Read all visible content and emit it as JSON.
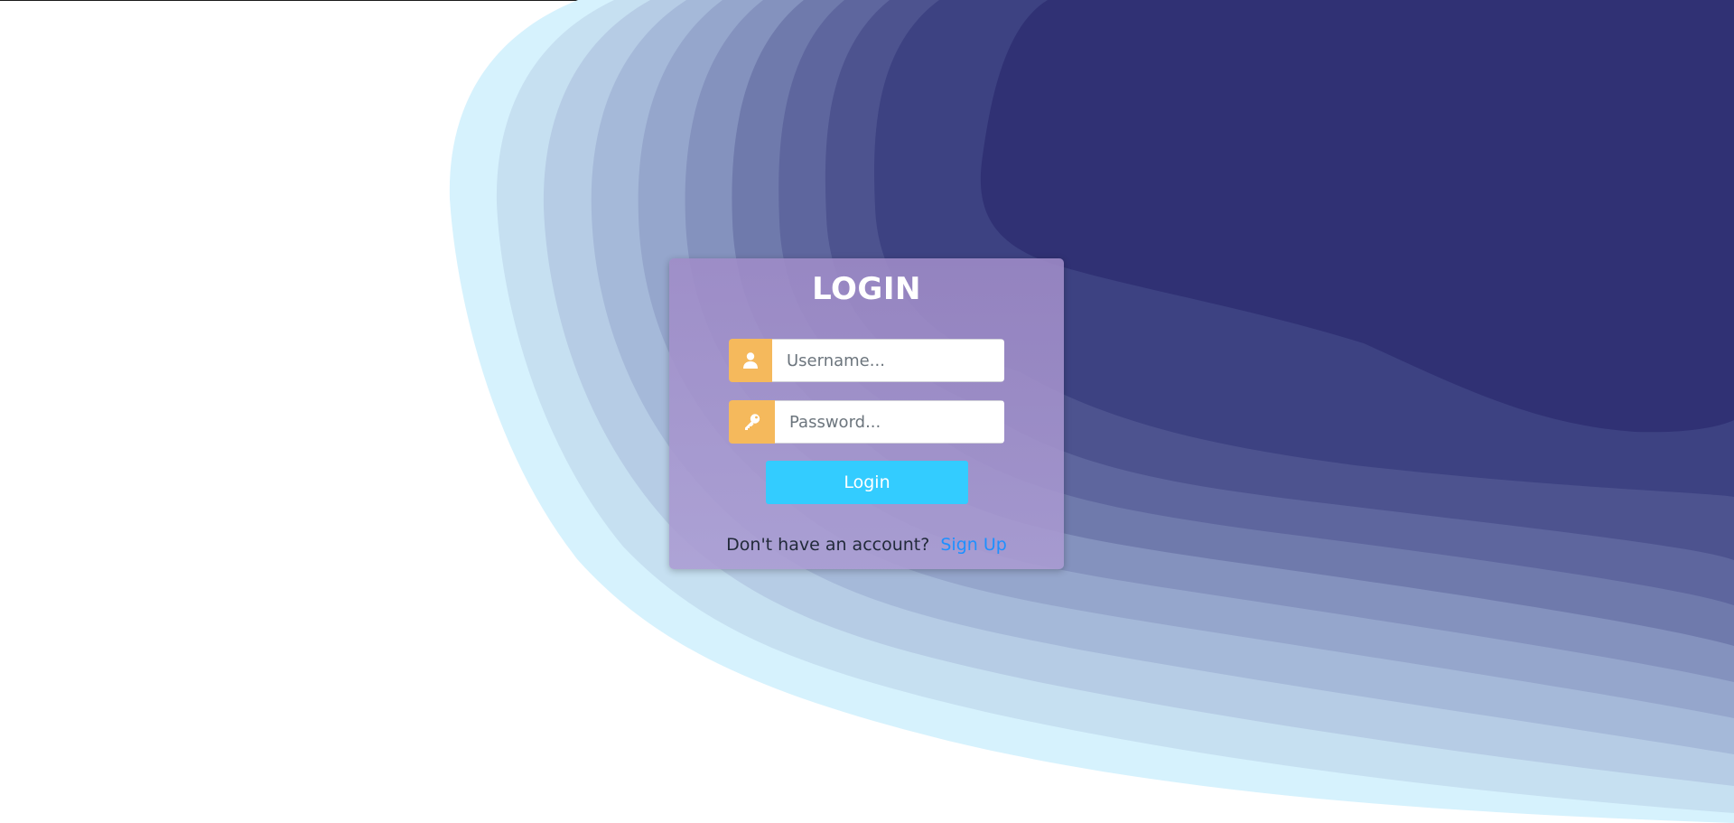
{
  "login": {
    "title": "LOGIN",
    "username_placeholder": "Username...",
    "password_placeholder": "Password...",
    "username_icon": "user-icon",
    "password_icon": "key-icon",
    "submit_label": "Login",
    "signup_prompt": "Don't have an account?",
    "signup_link": "Sign Up"
  },
  "colors": {
    "icon_box": "#f5b95c",
    "button": "#33ccff",
    "link": "#1e90ff",
    "wave_dark": "#303174",
    "wave_light": "#d6f2fd"
  }
}
